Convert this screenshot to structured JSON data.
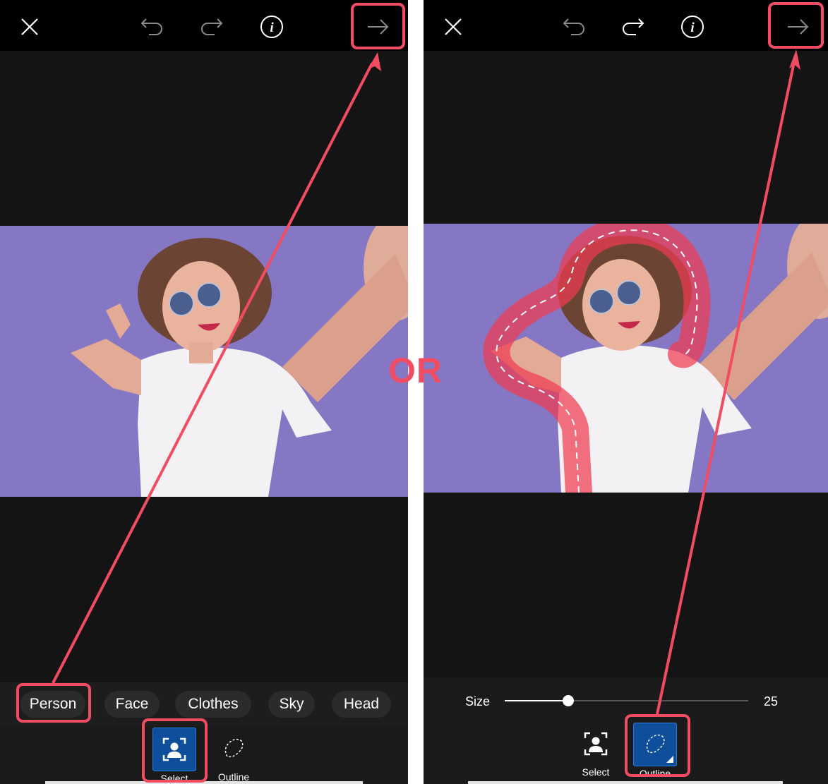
{
  "left_screen": {
    "chips": [
      "Person",
      "Face",
      "Clothes",
      "Sky",
      "Head"
    ],
    "tools": {
      "select_label": "Select",
      "outline_label": "Outline"
    }
  },
  "right_screen": {
    "size_label": "Size",
    "size_value": "25",
    "size_fraction": 0.26,
    "tools": {
      "select_label": "Select",
      "outline_label": "Outline"
    }
  },
  "separator_text": "OR",
  "colors": {
    "annotation": "#f24c63",
    "photo_background": "#8677c4",
    "active_tool": "#0f4e9a"
  }
}
